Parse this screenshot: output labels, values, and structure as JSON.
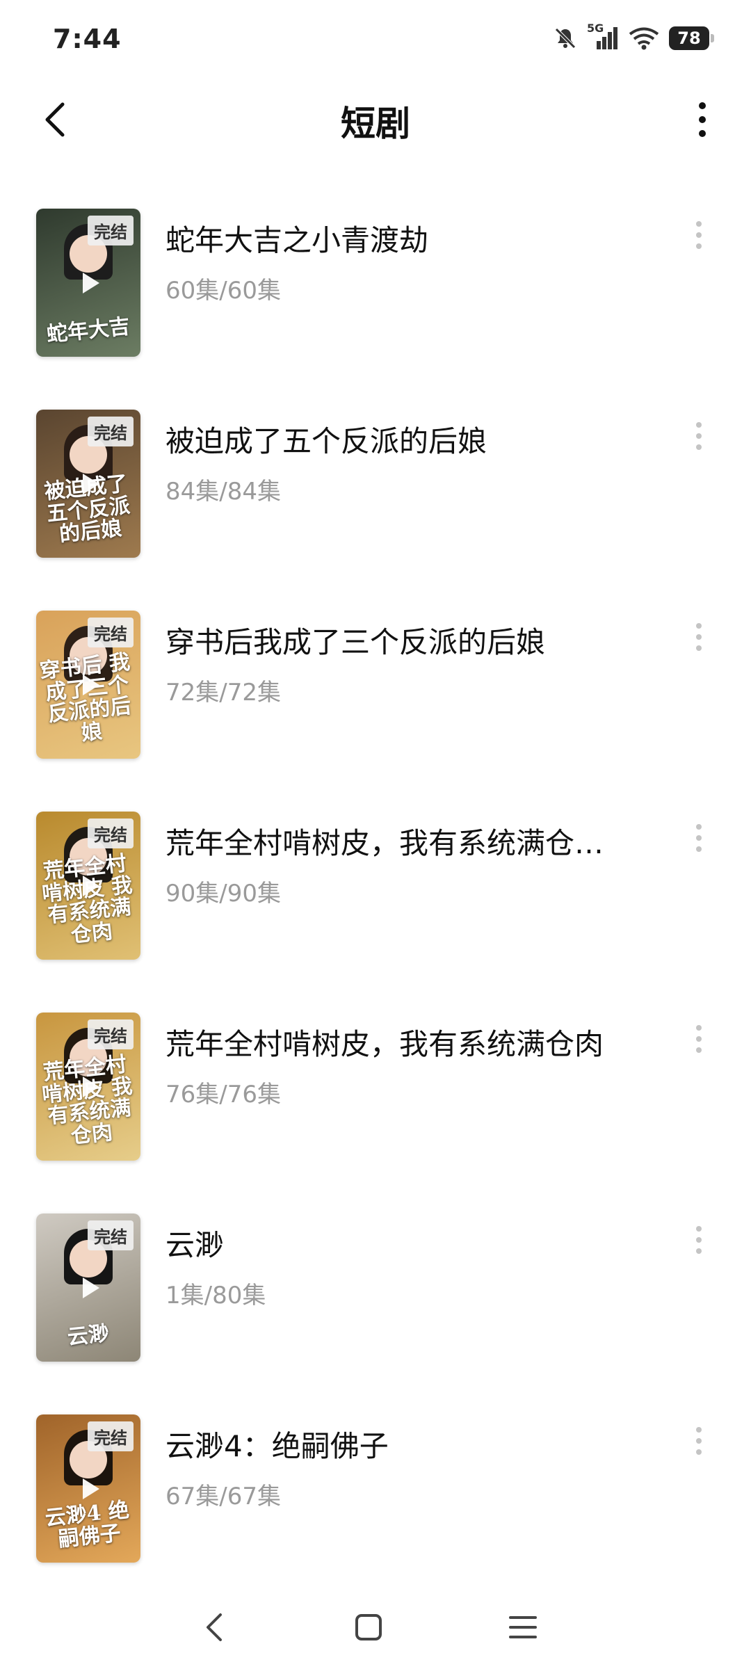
{
  "status_bar": {
    "time": "7:44",
    "network_label": "5G",
    "battery_level": "78",
    "icons": [
      "mute-bell-icon",
      "signal-icon",
      "wifi-icon",
      "battery-icon"
    ]
  },
  "header": {
    "title": "短剧",
    "back_icon": "back-arrow-icon",
    "more_icon": "more-vertical-icon"
  },
  "items": [
    {
      "title": "蛇年大吉之小青渡劫",
      "episodes": "60集/60集",
      "badge": "完结",
      "poster_text": "蛇年大吉",
      "colors": [
        "#2f3a2e",
        "#6c7d63"
      ],
      "hair": "#1d1d1d"
    },
    {
      "title": "被迫成了五个反派的后娘",
      "episodes": "84集/84集",
      "badge": "完结",
      "poster_text": "被迫成了五个反派的后娘",
      "colors": [
        "#5a4530",
        "#9e7a4e"
      ],
      "hair": "#2a1d16"
    },
    {
      "title": "穿书后我成了三个反派的后娘",
      "episodes": "72集/72集",
      "badge": "完结",
      "poster_text": "穿书后 我成了三个反派的后娘",
      "colors": [
        "#d9a25a",
        "#e8c680"
      ],
      "hair": "#2d2017"
    },
    {
      "title": "荒年全村啃树皮，我有系统满仓…",
      "episodes": "90集/90集",
      "badge": "完结",
      "poster_text": "荒年全村啃树皮 我有系统满仓肉",
      "colors": [
        "#b98a2e",
        "#e0c074"
      ],
      "hair": "#1f1a14"
    },
    {
      "title": "荒年全村啃树皮，我有系统满仓肉",
      "episodes": "76集/76集",
      "badge": "完结",
      "poster_text": "荒年全村啃树皮 我有系统满仓肉",
      "colors": [
        "#c8963f",
        "#e6cd8a"
      ],
      "hair": "#22190f"
    },
    {
      "title": "云渺",
      "episodes": "1集/80集",
      "badge": "完结",
      "poster_text": "云渺",
      "colors": [
        "#cfcac2",
        "#8d8676"
      ],
      "hair": "#151515"
    },
    {
      "title": "云渺4：绝嗣佛子",
      "episodes": "67集/67集",
      "badge": "完结",
      "poster_text": "云渺4 绝嗣佛子",
      "colors": [
        "#a0642a",
        "#e3a85a"
      ],
      "hair": "#1c140d"
    }
  ],
  "nav_bar": {
    "icons": [
      "nav-back-icon",
      "nav-home-icon",
      "nav-recents-icon"
    ]
  }
}
